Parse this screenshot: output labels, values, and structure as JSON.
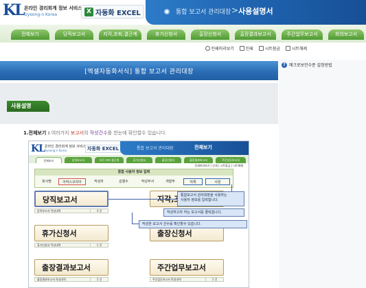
{
  "header": {
    "logo_mark": "KL",
    "logo_text_ko": "온라인 경리회계 정보 서비스",
    "logo_text_en": "Gyeong-n Korea",
    "excel_logo": "자동화 EXCEL",
    "breadcrumb": "통합 보고서 관리대장",
    "page_title": "사용설명서"
  },
  "nav": {
    "tabs": [
      "전체보기",
      "당직보고서",
      "지각,조퇴,결근계",
      "휴가신청서",
      "출장신청서",
      "출장결과보고서",
      "주간업무보고서",
      "회의보고서"
    ]
  },
  "toolbar": {
    "items": [
      "인쇄미리보기",
      "인쇄",
      "시트잠금",
      "시트해제"
    ]
  },
  "main": {
    "banner_title": "[엑셀자동화서식] 통합 보고서 관리대장",
    "section_tab": "사용설명",
    "desc_label": "1.전체보기 :",
    "desc_parts": [
      "여러가지 ",
      "보고서",
      "의 ",
      "작성건수",
      "를 한눈에 확인할수 있습니다."
    ]
  },
  "embedded": {
    "logo_mark": "KL",
    "logo_text_ko": "온라인 경리회계 정보 서비스",
    "logo_text_en": "Gyeong-n Korea",
    "excel_logo": "자동화 EXCEL",
    "breadcrumb": "통합 보고서 관리대장",
    "title": "전체보기",
    "tabs": [
      "전체보기",
      "당직보고서",
      "지각 조퇴 결근계",
      "휴가신청서",
      "출장신청서",
      "출장결과보고서",
      "주간업무보고서"
    ],
    "tools": "인쇄미리보기 | 인쇄 | 시트잠금 | 시트해제",
    "info_head": "통합 사용자 정보 입력",
    "info_cells": [
      "회사명",
      "아작스코리아",
      "작성자",
      "김철수",
      "작성부서",
      "개발부",
      "직책",
      "사원"
    ],
    "cards": [
      "당직보고서",
      "지각,조",
      "휴가신청서",
      "출장신청서",
      "출장결과보고서",
      "주간업무보고서"
    ],
    "subs": [
      "당직보고서 작성내역",
      "휴가신청서 작성내역",
      "출장결과보고서 작성내역",
      "주간업무보고서 작성내역"
    ],
    "sub_counts": [
      "3 건",
      "1 건",
      "1 건",
      "1 건"
    ],
    "callouts": [
      "통합보고서 관리대장을 사용하는\n사용자 정보를 입력합니다.",
      "작성하고자 하는 보고서를 클릭합니다.",
      "작성한 보고서 건수를 확인할수 있습니다."
    ]
  },
  "sidebar": {
    "label": "매크로보안수준 설정방법"
  },
  "colors": {
    "header_blue": "#1d5fab",
    "nav_green": "#4f9a33",
    "section_green": "#2a6a1f",
    "report_red": "#c0392b",
    "count_purple": "#7b3fa0"
  }
}
